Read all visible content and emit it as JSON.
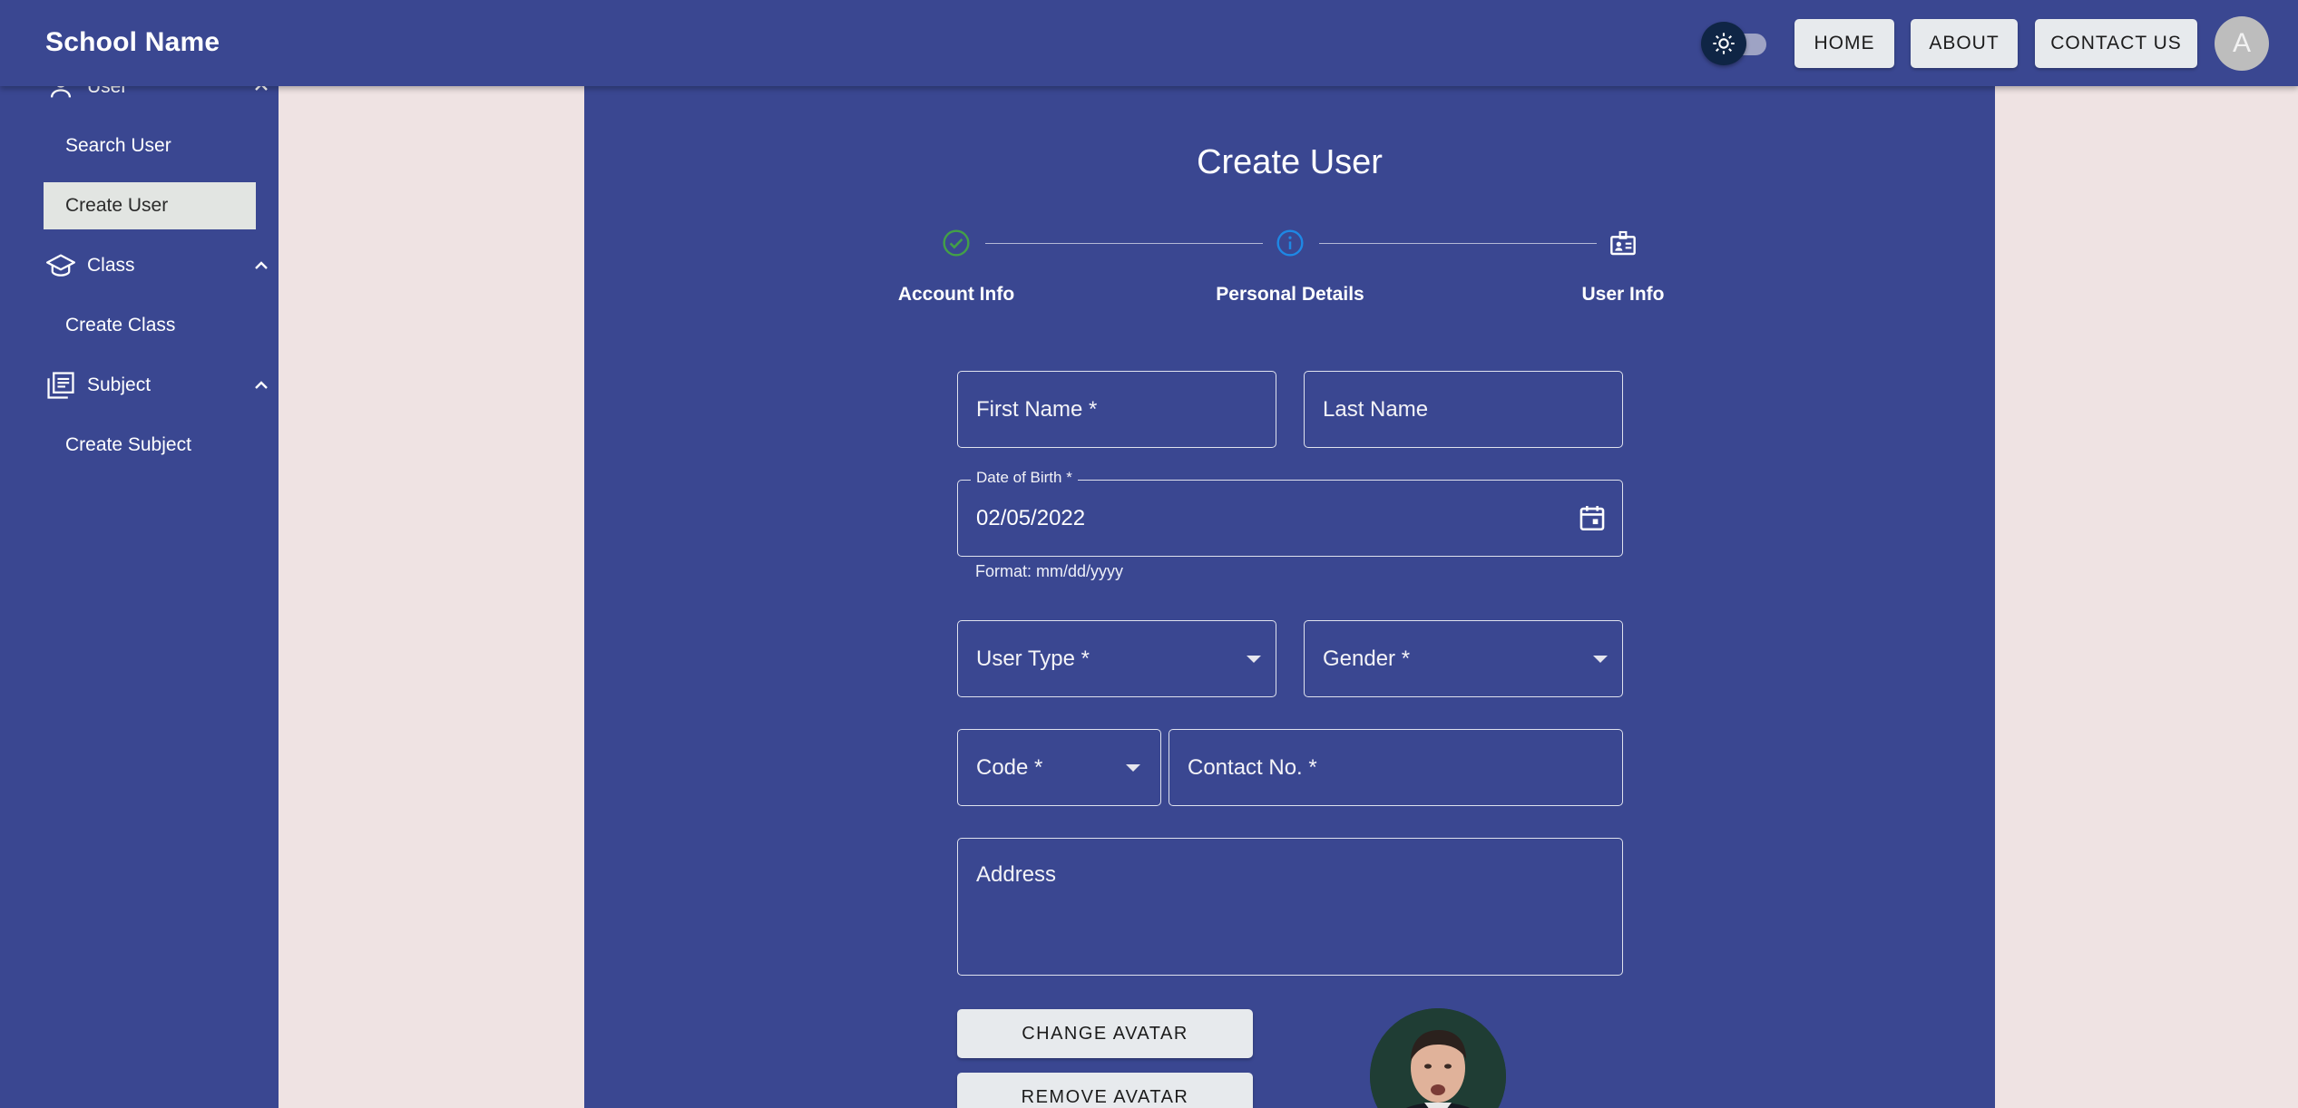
{
  "app": {
    "brand": "School Name",
    "avatar_letter": "A"
  },
  "nav": {
    "home": "HOME",
    "about": "ABOUT",
    "contact": "CONTACT US"
  },
  "sidebar": {
    "groups": [
      {
        "label": "User",
        "items": [
          "Search User",
          "Create User"
        ],
        "active": "Create User"
      },
      {
        "label": "Class",
        "items": [
          "Create Class"
        ]
      },
      {
        "label": "Subject",
        "items": [
          "Create Subject"
        ]
      }
    ]
  },
  "page": {
    "title": "Create User",
    "steps": [
      {
        "label": "Account Info",
        "status": "completed"
      },
      {
        "label": "Personal Details",
        "status": "active"
      },
      {
        "label": "User Info",
        "status": "pending"
      }
    ]
  },
  "form": {
    "first_name": "First Name *",
    "last_name": "Last Name",
    "dob_label": "Date of Birth *",
    "dob_value": "02/05/2022",
    "dob_helper": "Format: mm/dd/yyyy",
    "user_type": "User Type *",
    "gender": "Gender *",
    "code": "Code *",
    "contact": "Contact No. *",
    "address": "Address",
    "change_avatar": "CHANGE AVATAR",
    "remove_avatar": "REMOVE AVATAR"
  },
  "colors": {
    "primary": "#3a4791",
    "background": "#efe3e3",
    "step_done": "#43a047",
    "step_active": "#1e88e5"
  }
}
